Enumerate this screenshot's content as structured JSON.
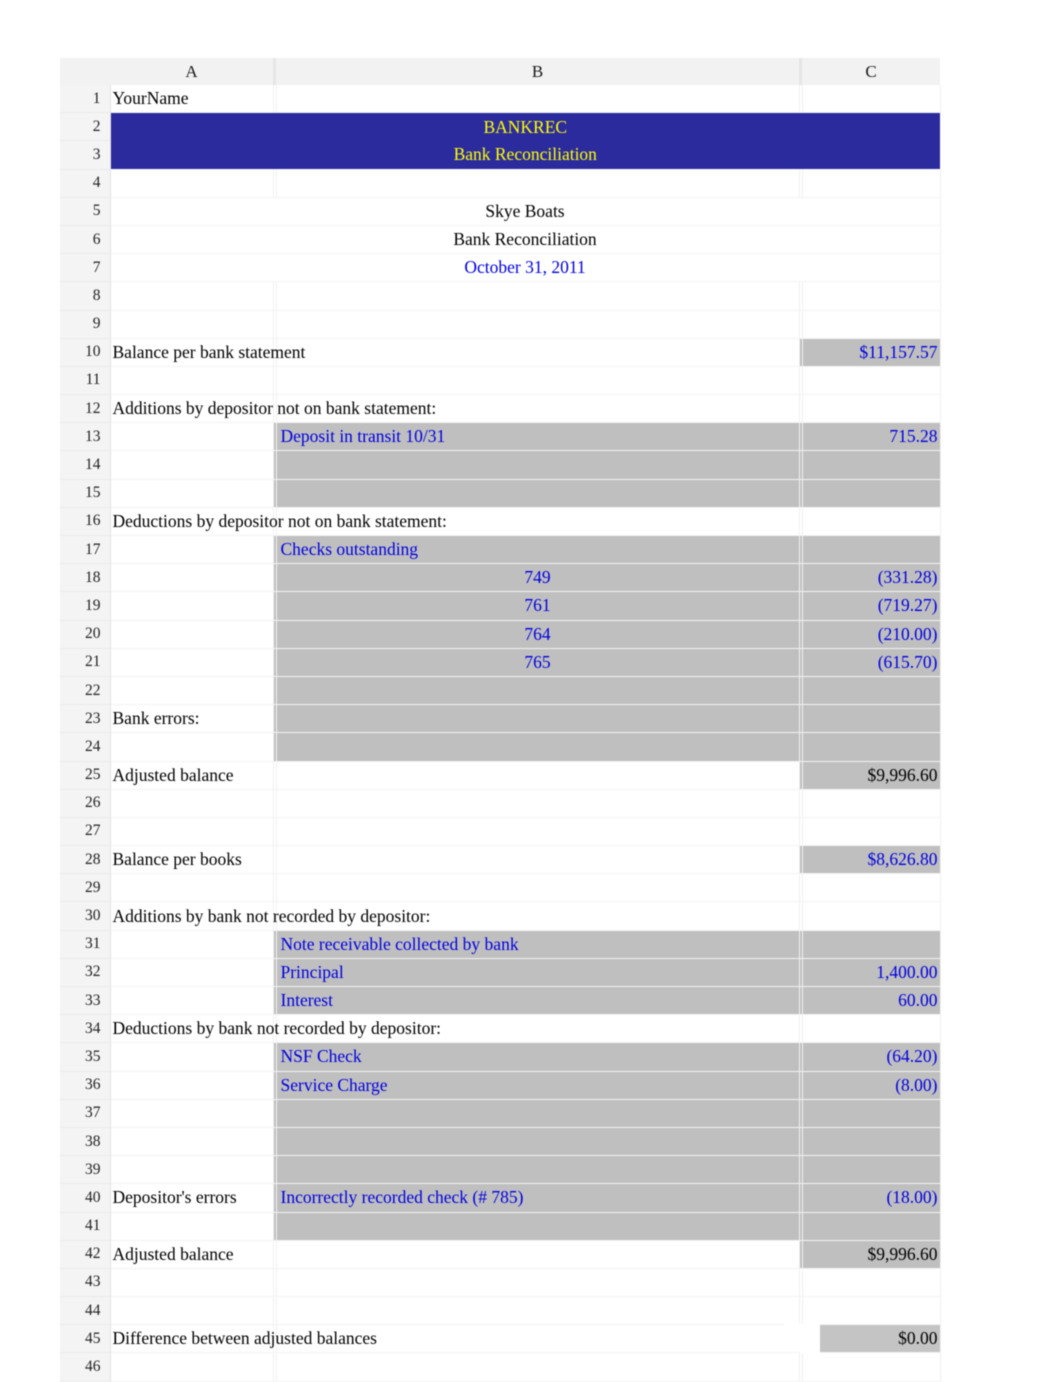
{
  "spreadsheet": {
    "column_headers": [
      "A",
      "",
      "B",
      "",
      "C"
    ],
    "row_numbers": [
      1,
      2,
      3,
      4,
      5,
      6,
      7,
      8,
      9,
      10,
      11,
      12,
      13,
      14,
      15,
      16,
      17,
      18,
      19,
      20,
      21,
      22,
      23,
      24,
      25,
      26,
      27,
      28,
      29,
      30,
      31,
      32,
      33,
      34,
      35,
      36,
      37,
      38,
      39,
      40,
      41,
      42,
      43,
      44,
      45,
      46
    ],
    "colors": {
      "banner_background": "#2b2b9e",
      "banner_text": "#ffff00",
      "entry_text": "#0000e0",
      "label_text": "#000000",
      "shaded_cell": "#bfbfbf"
    }
  },
  "cells": {
    "row1_a": "YourName",
    "banner_title": "BANKREC",
    "banner_subtitle": "Bank Reconciliation",
    "company": "Skye Boats",
    "report_title": "Bank Reconciliation",
    "report_date": "October 31, 2011",
    "balance_per_bank_label": "Balance per bank statement",
    "balance_per_bank_value": "$11,157.57",
    "additions_depositor_label": "Additions by depositor not on bank statement:",
    "deposit_in_transit_label": "Deposit in transit 10/31",
    "deposit_in_transit_value": "715.28",
    "deductions_depositor_label": "Deductions by depositor not on bank statement:",
    "checks_outstanding_label": "Checks outstanding",
    "checks": [
      {
        "number": "749",
        "amount": "(331.28)"
      },
      {
        "number": "761",
        "amount": "(719.27)"
      },
      {
        "number": "764",
        "amount": "(210.00)"
      },
      {
        "number": "765",
        "amount": "(615.70)"
      }
    ],
    "bank_errors_label": "Bank errors:",
    "adjusted_balance_bank_label": "Adjusted balance",
    "adjusted_balance_bank_value": "$9,996.60",
    "balance_per_books_label": "Balance per books",
    "balance_per_books_value": "$8,626.80",
    "additions_bank_label": "Additions by bank not recorded by depositor:",
    "note_receivable_label": "Note receivable collected by bank",
    "principal_label": "Principal",
    "principal_value": "1,400.00",
    "interest_label": "Interest",
    "interest_value": "60.00",
    "deductions_bank_label": "Deductions by bank not recorded by depositor:",
    "nsf_check_label": "NSF Check",
    "nsf_check_value": "(64.20)",
    "service_charge_label": "Service Charge",
    "service_charge_value": "(8.00)",
    "depositor_errors_label": "Depositor's errors",
    "incorrect_check_label": "Incorrectly recorded check (# 785)",
    "incorrect_check_value": "(18.00)",
    "adjusted_balance_books_label": "Adjusted balance",
    "adjusted_balance_books_value": "$9,996.60",
    "difference_label": "Difference between adjusted balances",
    "difference_value": "$0.00"
  }
}
